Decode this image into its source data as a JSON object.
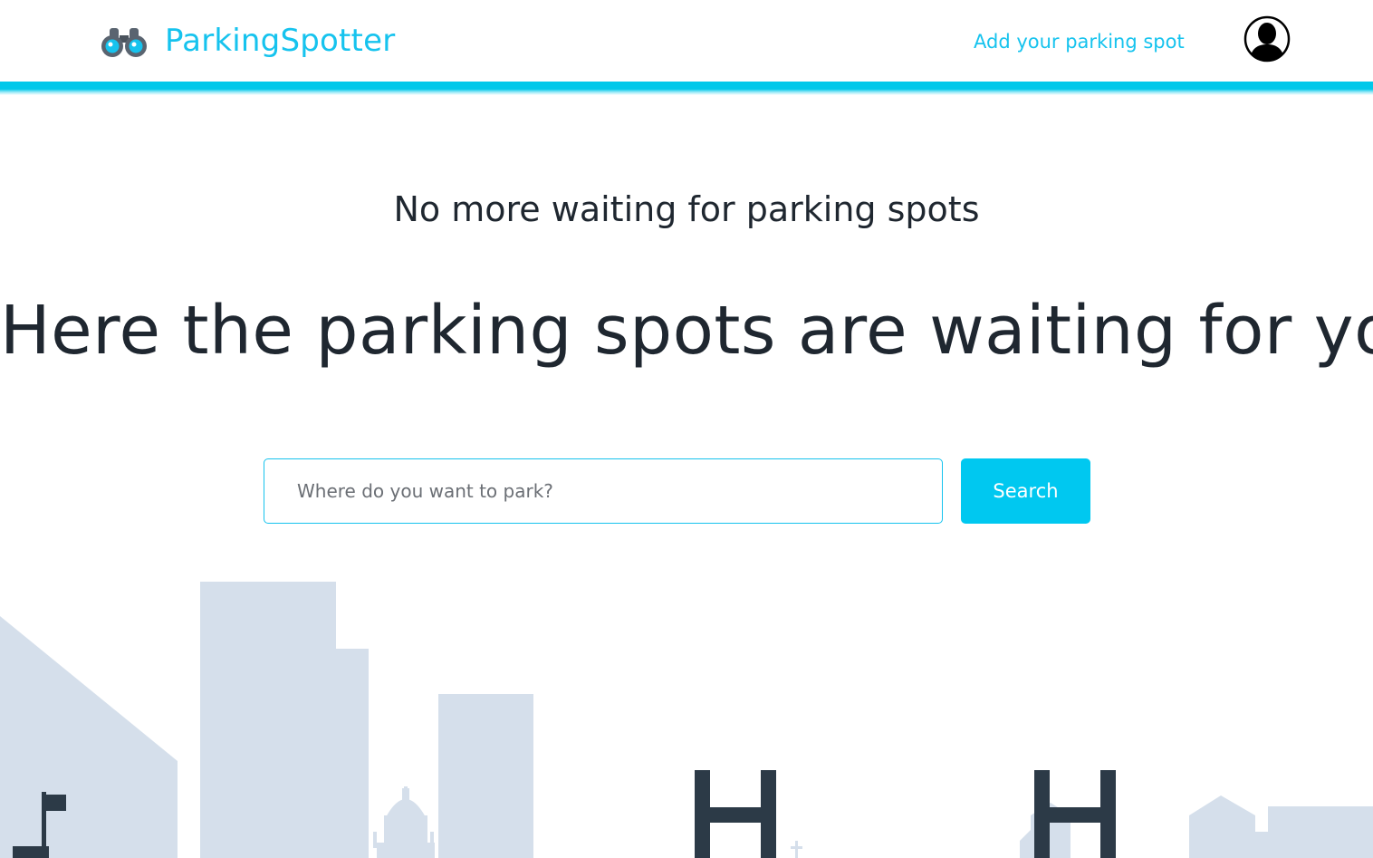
{
  "header": {
    "brand_name": "ParkingSpotter",
    "logo_icon": "binoculars-icon",
    "add_spot_link": "Add your parking spot",
    "avatar_icon": "user-avatar-icon"
  },
  "hero": {
    "subtitle": "No more waiting for parking spots",
    "title": "Here the parking spots are waiting for you"
  },
  "search": {
    "placeholder": "Where do you want to park?",
    "value": "",
    "button_label": "Search"
  },
  "colors": {
    "accent": "#16c3ee",
    "button": "#00c8f0",
    "text": "#1f2730",
    "skyline_light": "#d5dfeb",
    "skyline_dark": "#2c3a47"
  }
}
